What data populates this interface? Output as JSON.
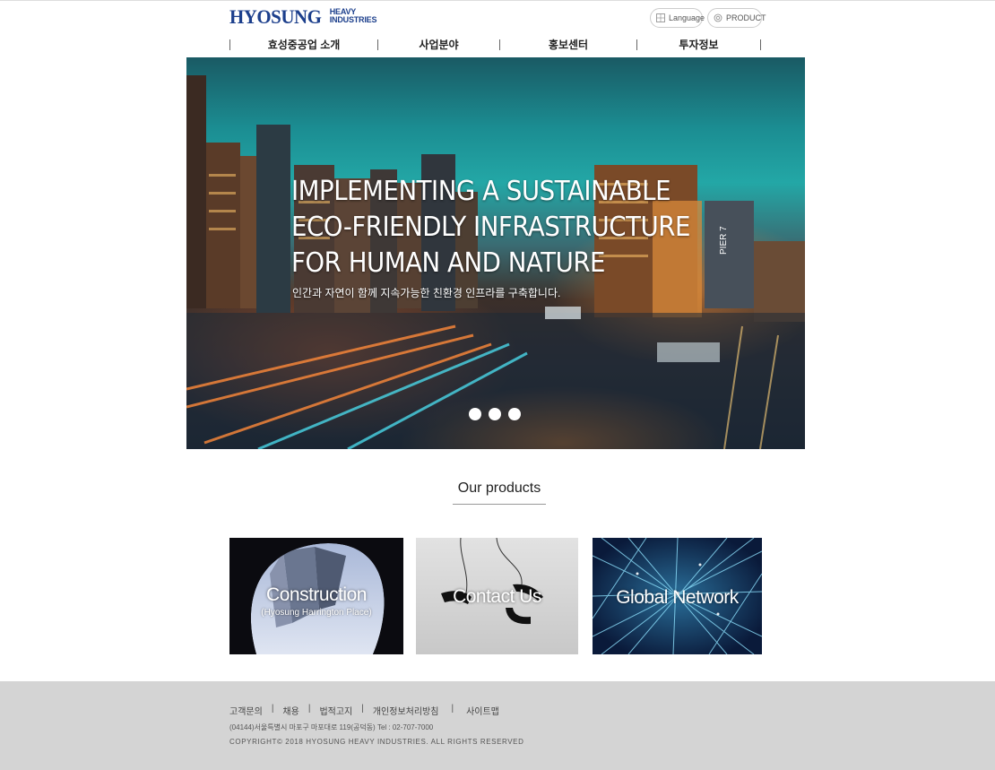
{
  "header": {
    "logo_main": "HYOSUNG",
    "logo_sub_1": "HEAVY",
    "logo_sub_2": "INDUSTRIES",
    "language_label": "Language",
    "product_label": "PRODUCT"
  },
  "nav": {
    "items": [
      {
        "label": "효성중공업 소개"
      },
      {
        "label": "사업분야"
      },
      {
        "label": "홍보센터"
      },
      {
        "label": "투자정보"
      }
    ]
  },
  "hero": {
    "title_line_1": "IMPLEMENTING A SUSTAINABLE",
    "title_line_2": "ECO-FRIENDLY INFRASTRUCTURE",
    "title_line_3": "FOR HUMAN AND NATURE",
    "subtitle": "인간과 자연이 함께 지속가능한 친환경 인프라를 구축합니다.",
    "sign_text": "PIER 7",
    "slides": 3
  },
  "products": {
    "title": "Our products",
    "cards": [
      {
        "label": "Construction",
        "sub": "(Hyosung Harrington Place)"
      },
      {
        "label": "Contact Us",
        "sub": ""
      },
      {
        "label": "Global Network",
        "sub": ""
      }
    ]
  },
  "footer": {
    "links": [
      {
        "label": "고객문의"
      },
      {
        "label": "채용"
      },
      {
        "label": "법적고지"
      },
      {
        "label": "개인정보처리방침"
      },
      {
        "label": "사이트맵"
      }
    ],
    "address": "(04144)서울특별시 마포구 마포대로 119(공덕동) Tel : 02-707-7000",
    "copyright": "COPYRIGHT© 2018 HYOSUNG HEAVY INDUSTRIES. ALL RIGHTS RESERVED"
  },
  "colors": {
    "brand": "#1c3f8c",
    "footer_bg": "#d4d4d4"
  }
}
